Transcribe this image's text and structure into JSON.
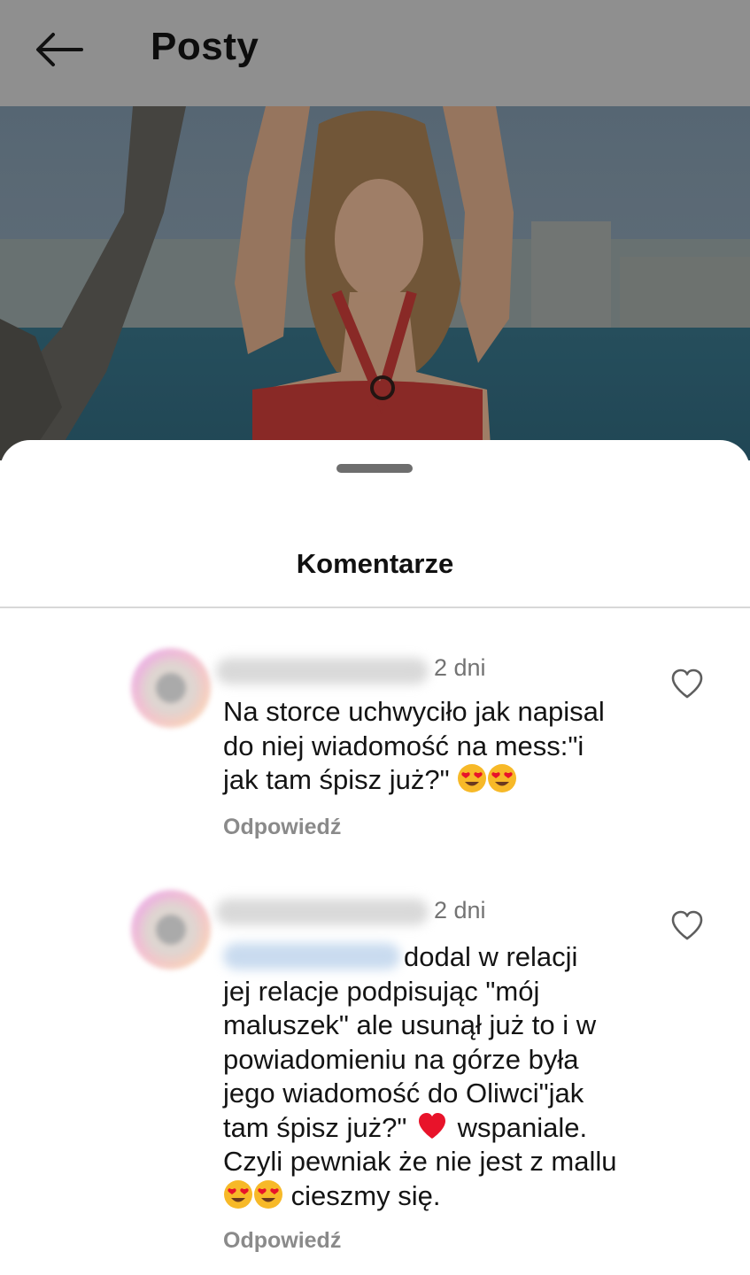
{
  "header": {
    "title": "Posty",
    "back_icon": "arrow-left-icon",
    "background": "#8f8f8f"
  },
  "post_image": {
    "description_hidden": true
  },
  "comments_sheet": {
    "title": "Komentarze",
    "comments": [
      {
        "time": "2 dni",
        "text_line1": "Na storce uchwyciło jak napisal",
        "text_line2": "do niej wiadomość na mess:\"i",
        "text_line3": "jak tam śpisz już?\"",
        "emoji_count": 2,
        "reply_label": "Odpowiedź",
        "like_icon": "heart-outline-icon"
      },
      {
        "time": "2 dni",
        "text_after_mention": "dodal w relacji",
        "text_line2": "jej relacje podpisując \"mój",
        "text_line3": "maluszek\" ale usunął już to i w",
        "text_line4": "powiadomieniu na górze była",
        "text_line5": "jego wiadomość do Oliwci\"jak",
        "text_line6a": "tam śpisz już?\"",
        "text_line6b": "wspaniale.",
        "text_line7": "Czyli pewniak że nie jest z mallu",
        "text_line8": "cieszmy się.",
        "reply_label": "Odpowiedź",
        "like_icon": "heart-outline-icon"
      }
    ]
  },
  "colors": {
    "secondary_text": "#737373",
    "heart_red": "#e8132a",
    "emoji_yellow": "#f7b928"
  }
}
